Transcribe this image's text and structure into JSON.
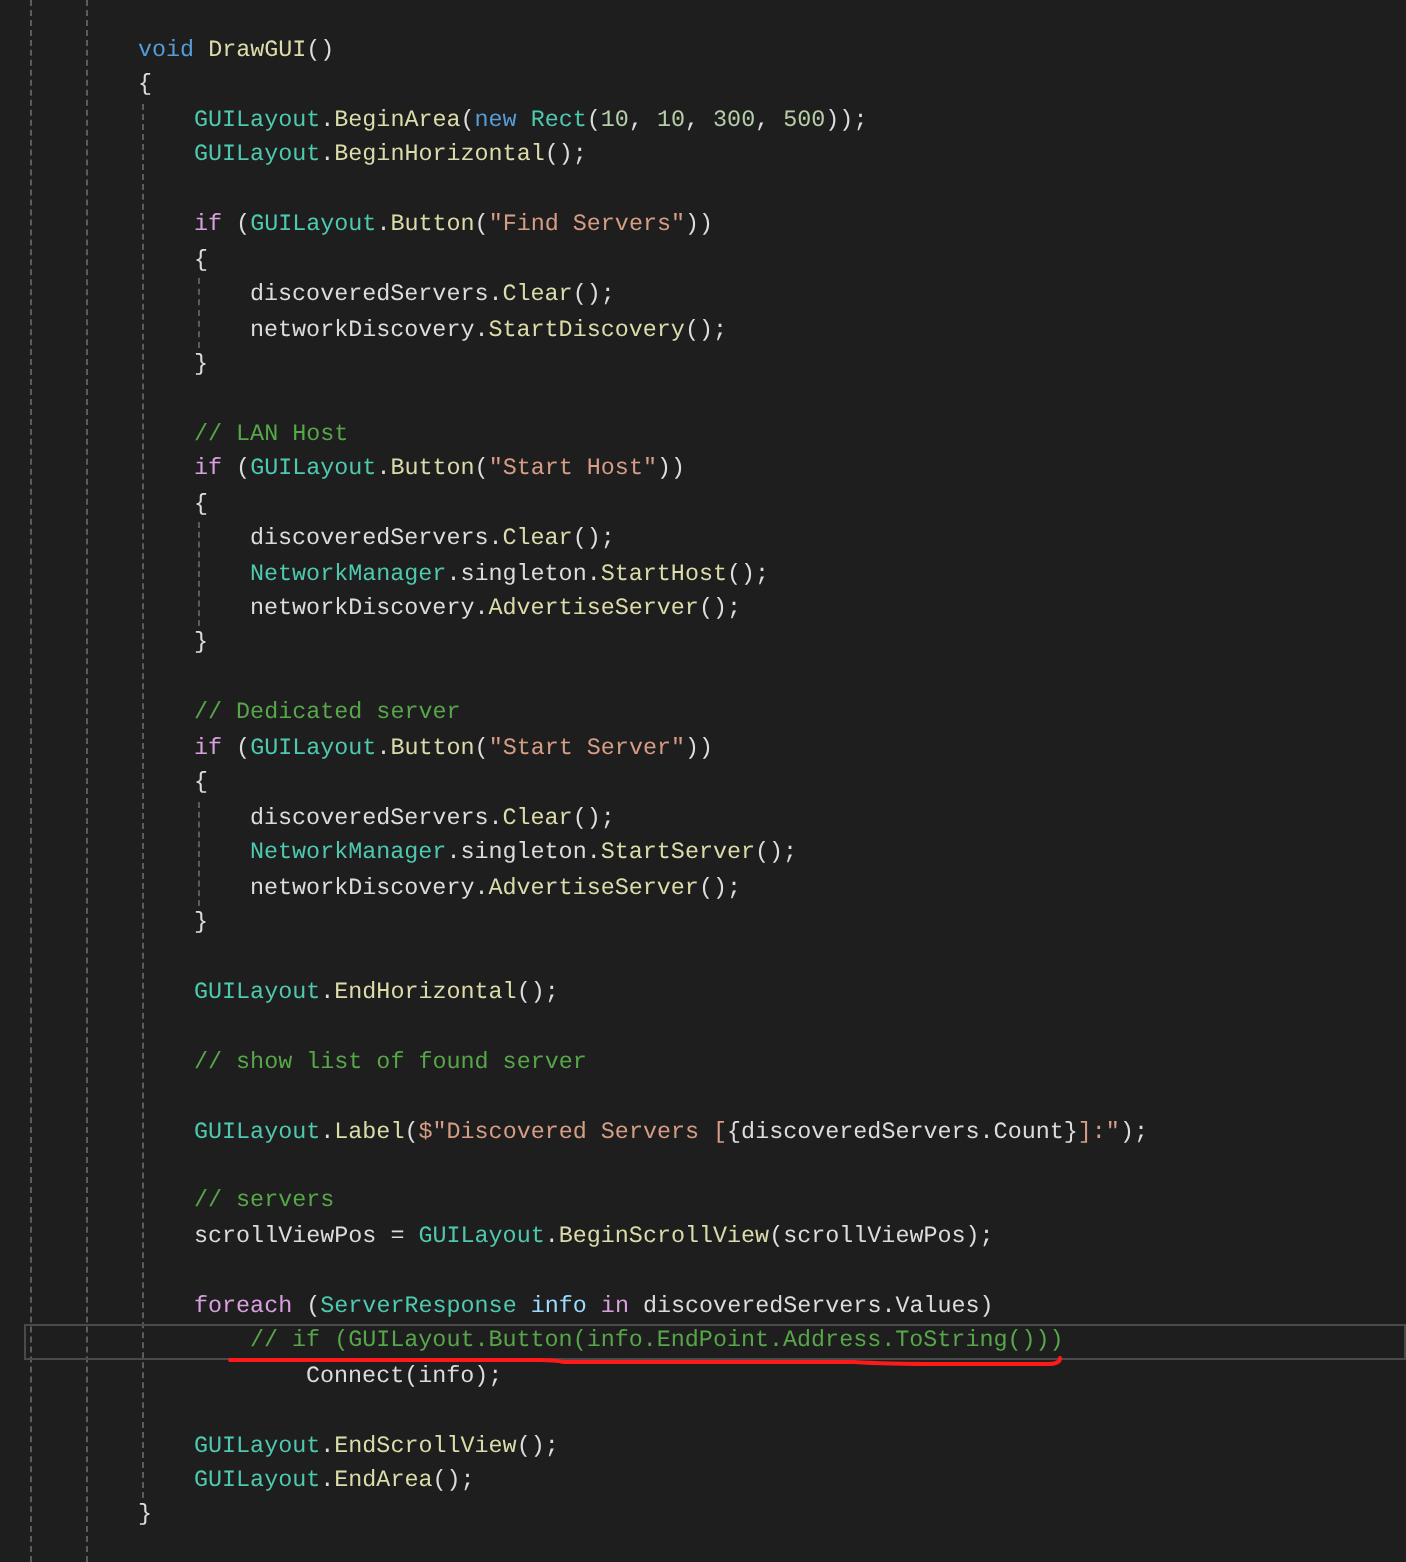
{
  "editor": {
    "code": [
      {
        "kind": "block",
        "children": [
          {
            "kind": "block",
            "children": [
              {
                "kind": "line",
                "current": false,
                "tokens": [
                  {
                    "kind": "keyword",
                    "text": "void"
                  },
                  {
                    "kind": "method",
                    "text": " DrawGUI"
                  },
                  {
                    "kind": "plain",
                    "text": "()"
                  }
                ]
              },
              {
                "kind": "line",
                "current": false,
                "tokens": [
                  {
                    "kind": "plain",
                    "text": "{"
                  }
                ]
              },
              {
                "kind": "block",
                "children": [
                  {
                    "kind": "line",
                    "current": false,
                    "tokens": [
                      {
                        "kind": "type",
                        "text": "GUILayout"
                      },
                      {
                        "kind": "plain",
                        "text": "."
                      },
                      {
                        "kind": "method",
                        "text": "BeginArea"
                      },
                      {
                        "kind": "plain",
                        "text": "("
                      },
                      {
                        "kind": "keyword",
                        "text": "new"
                      },
                      {
                        "kind": "type",
                        "text": " Rect"
                      },
                      {
                        "kind": "plain",
                        "text": "("
                      },
                      {
                        "kind": "number",
                        "text": "10"
                      },
                      {
                        "kind": "plain",
                        "text": ", "
                      },
                      {
                        "kind": "number",
                        "text": "10"
                      },
                      {
                        "kind": "plain",
                        "text": ", "
                      },
                      {
                        "kind": "number",
                        "text": "300"
                      },
                      {
                        "kind": "plain",
                        "text": ", "
                      },
                      {
                        "kind": "number",
                        "text": "500"
                      },
                      {
                        "kind": "plain",
                        "text": "));"
                      }
                    ]
                  },
                  {
                    "kind": "line",
                    "current": false,
                    "tokens": [
                      {
                        "kind": "type",
                        "text": "GUILayout"
                      },
                      {
                        "kind": "plain",
                        "text": "."
                      },
                      {
                        "kind": "method",
                        "text": "BeginHorizontal"
                      },
                      {
                        "kind": "plain",
                        "text": "();"
                      }
                    ]
                  },
                  {
                    "kind": "blank"
                  },
                  {
                    "kind": "line",
                    "current": false,
                    "tokens": [
                      {
                        "kind": "control",
                        "text": "if"
                      },
                      {
                        "kind": "plain",
                        "text": " ("
                      },
                      {
                        "kind": "type",
                        "text": "GUILayout"
                      },
                      {
                        "kind": "plain",
                        "text": "."
                      },
                      {
                        "kind": "method",
                        "text": "Button"
                      },
                      {
                        "kind": "plain",
                        "text": "("
                      },
                      {
                        "kind": "string",
                        "text": "\"Find Servers\""
                      },
                      {
                        "kind": "plain",
                        "text": "))"
                      }
                    ]
                  },
                  {
                    "kind": "line",
                    "current": false,
                    "tokens": [
                      {
                        "kind": "plain",
                        "text": "{"
                      }
                    ]
                  },
                  {
                    "kind": "block",
                    "children": [
                      {
                        "kind": "line",
                        "current": false,
                        "tokens": [
                          {
                            "kind": "plain",
                            "text": "discoveredServers."
                          },
                          {
                            "kind": "method",
                            "text": "Clear"
                          },
                          {
                            "kind": "plain",
                            "text": "();"
                          }
                        ]
                      },
                      {
                        "kind": "line",
                        "current": false,
                        "tokens": [
                          {
                            "kind": "plain",
                            "text": "networkDiscovery."
                          },
                          {
                            "kind": "method",
                            "text": "StartDiscovery"
                          },
                          {
                            "kind": "plain",
                            "text": "();"
                          }
                        ]
                      }
                    ]
                  },
                  {
                    "kind": "line",
                    "current": false,
                    "tokens": [
                      {
                        "kind": "plain",
                        "text": "}"
                      }
                    ]
                  },
                  {
                    "kind": "blank"
                  },
                  {
                    "kind": "line",
                    "current": false,
                    "tokens": [
                      {
                        "kind": "comment",
                        "text": "// LAN Host"
                      }
                    ]
                  },
                  {
                    "kind": "line",
                    "current": false,
                    "tokens": [
                      {
                        "kind": "control",
                        "text": "if"
                      },
                      {
                        "kind": "plain",
                        "text": " ("
                      },
                      {
                        "kind": "type",
                        "text": "GUILayout"
                      },
                      {
                        "kind": "plain",
                        "text": "."
                      },
                      {
                        "kind": "method",
                        "text": "Button"
                      },
                      {
                        "kind": "plain",
                        "text": "("
                      },
                      {
                        "kind": "string",
                        "text": "\"Start Host\""
                      },
                      {
                        "kind": "plain",
                        "text": "))"
                      }
                    ]
                  },
                  {
                    "kind": "line",
                    "current": false,
                    "tokens": [
                      {
                        "kind": "plain",
                        "text": "{"
                      }
                    ]
                  },
                  {
                    "kind": "block",
                    "children": [
                      {
                        "kind": "line",
                        "current": false,
                        "tokens": [
                          {
                            "kind": "plain",
                            "text": "discoveredServers."
                          },
                          {
                            "kind": "method",
                            "text": "Clear"
                          },
                          {
                            "kind": "plain",
                            "text": "();"
                          }
                        ]
                      },
                      {
                        "kind": "line",
                        "current": false,
                        "tokens": [
                          {
                            "kind": "type",
                            "text": "NetworkManager"
                          },
                          {
                            "kind": "plain",
                            "text": ".singleton."
                          },
                          {
                            "kind": "method",
                            "text": "StartHost"
                          },
                          {
                            "kind": "plain",
                            "text": "();"
                          }
                        ]
                      },
                      {
                        "kind": "line",
                        "current": false,
                        "tokens": [
                          {
                            "kind": "plain",
                            "text": "networkDiscovery."
                          },
                          {
                            "kind": "method",
                            "text": "AdvertiseServer"
                          },
                          {
                            "kind": "plain",
                            "text": "();"
                          }
                        ]
                      }
                    ]
                  },
                  {
                    "kind": "line",
                    "current": false,
                    "tokens": [
                      {
                        "kind": "plain",
                        "text": "}"
                      }
                    ]
                  },
                  {
                    "kind": "blank"
                  },
                  {
                    "kind": "line",
                    "current": false,
                    "tokens": [
                      {
                        "kind": "comment",
                        "text": "// Dedicated server"
                      }
                    ]
                  },
                  {
                    "kind": "line",
                    "current": false,
                    "tokens": [
                      {
                        "kind": "control",
                        "text": "if"
                      },
                      {
                        "kind": "plain",
                        "text": " ("
                      },
                      {
                        "kind": "type",
                        "text": "GUILayout"
                      },
                      {
                        "kind": "plain",
                        "text": "."
                      },
                      {
                        "kind": "method",
                        "text": "Button"
                      },
                      {
                        "kind": "plain",
                        "text": "("
                      },
                      {
                        "kind": "string",
                        "text": "\"Start Server\""
                      },
                      {
                        "kind": "plain",
                        "text": "))"
                      }
                    ]
                  },
                  {
                    "kind": "line",
                    "current": false,
                    "tokens": [
                      {
                        "kind": "plain",
                        "text": "{"
                      }
                    ]
                  },
                  {
                    "kind": "block",
                    "children": [
                      {
                        "kind": "line",
                        "current": false,
                        "tokens": [
                          {
                            "kind": "plain",
                            "text": "discoveredServers."
                          },
                          {
                            "kind": "method",
                            "text": "Clear"
                          },
                          {
                            "kind": "plain",
                            "text": "();"
                          }
                        ]
                      },
                      {
                        "kind": "line",
                        "current": false,
                        "tokens": [
                          {
                            "kind": "type",
                            "text": "NetworkManager"
                          },
                          {
                            "kind": "plain",
                            "text": ".singleton."
                          },
                          {
                            "kind": "method",
                            "text": "StartServer"
                          },
                          {
                            "kind": "plain",
                            "text": "();"
                          }
                        ]
                      },
                      {
                        "kind": "line",
                        "current": false,
                        "tokens": [
                          {
                            "kind": "plain",
                            "text": "networkDiscovery."
                          },
                          {
                            "kind": "method",
                            "text": "AdvertiseServer"
                          },
                          {
                            "kind": "plain",
                            "text": "();"
                          }
                        ]
                      }
                    ]
                  },
                  {
                    "kind": "line",
                    "current": false,
                    "tokens": [
                      {
                        "kind": "plain",
                        "text": "}"
                      }
                    ]
                  },
                  {
                    "kind": "blank"
                  },
                  {
                    "kind": "line",
                    "current": false,
                    "tokens": [
                      {
                        "kind": "type",
                        "text": "GUILayout"
                      },
                      {
                        "kind": "plain",
                        "text": "."
                      },
                      {
                        "kind": "method",
                        "text": "EndHorizontal"
                      },
                      {
                        "kind": "plain",
                        "text": "();"
                      }
                    ]
                  },
                  {
                    "kind": "blank"
                  },
                  {
                    "kind": "line",
                    "current": false,
                    "tokens": [
                      {
                        "kind": "comment",
                        "text": "// show list of found server"
                      }
                    ]
                  },
                  {
                    "kind": "blank"
                  },
                  {
                    "kind": "line",
                    "current": false,
                    "tokens": [
                      {
                        "kind": "type",
                        "text": "GUILayout"
                      },
                      {
                        "kind": "plain",
                        "text": "."
                      },
                      {
                        "kind": "method",
                        "text": "Label"
                      },
                      {
                        "kind": "plain",
                        "text": "("
                      },
                      {
                        "kind": "string",
                        "text": "$\"Discovered Servers ["
                      },
                      {
                        "kind": "plain",
                        "text": "{discoveredServers.Count}"
                      },
                      {
                        "kind": "string",
                        "text": "]:\""
                      },
                      {
                        "kind": "plain",
                        "text": ");"
                      }
                    ]
                  },
                  {
                    "kind": "blank"
                  },
                  {
                    "kind": "line",
                    "current": false,
                    "tokens": [
                      {
                        "kind": "comment",
                        "text": "// servers"
                      }
                    ]
                  },
                  {
                    "kind": "line",
                    "current": false,
                    "tokens": [
                      {
                        "kind": "plain",
                        "text": "scrollViewPos = "
                      },
                      {
                        "kind": "type",
                        "text": "GUILayout"
                      },
                      {
                        "kind": "plain",
                        "text": "."
                      },
                      {
                        "kind": "method",
                        "text": "BeginScrollView"
                      },
                      {
                        "kind": "plain",
                        "text": "(scrollViewPos);"
                      }
                    ]
                  },
                  {
                    "kind": "blank"
                  },
                  {
                    "kind": "line",
                    "current": false,
                    "tokens": [
                      {
                        "kind": "control",
                        "text": "foreach"
                      },
                      {
                        "kind": "plain",
                        "text": " ("
                      },
                      {
                        "kind": "type",
                        "text": "ServerResponse"
                      },
                      {
                        "kind": "local",
                        "text": " info"
                      },
                      {
                        "kind": "control",
                        "text": " in"
                      },
                      {
                        "kind": "plain",
                        "text": " discoveredServers.Values)"
                      }
                    ]
                  },
                  {
                    "kind": "indent",
                    "children": [
                      {
                        "kind": "line",
                        "current": true,
                        "tokens": [
                          {
                            "kind": "comment",
                            "text": "// if (GUILayout.Button(info.EndPoint.Address.ToString()))"
                          }
                        ]
                      },
                      {
                        "kind": "indent",
                        "children": [
                          {
                            "kind": "line",
                            "current": false,
                            "tokens": [
                              {
                                "kind": "plain",
                                "text": "Connect(info);"
                              }
                            ]
                          }
                        ]
                      }
                    ]
                  },
                  {
                    "kind": "blank"
                  },
                  {
                    "kind": "line",
                    "current": false,
                    "tokens": [
                      {
                        "kind": "type",
                        "text": "GUILayout"
                      },
                      {
                        "kind": "plain",
                        "text": "."
                      },
                      {
                        "kind": "method",
                        "text": "EndScrollView"
                      },
                      {
                        "kind": "plain",
                        "text": "();"
                      }
                    ]
                  },
                  {
                    "kind": "line",
                    "current": false,
                    "tokens": [
                      {
                        "kind": "type",
                        "text": "GUILayout"
                      },
                      {
                        "kind": "plain",
                        "text": "."
                      },
                      {
                        "kind": "method",
                        "text": "EndArea"
                      },
                      {
                        "kind": "plain",
                        "text": "();"
                      }
                    ]
                  }
                ]
              },
              {
                "kind": "line",
                "current": false,
                "tokens": [
                  {
                    "kind": "plain",
                    "text": "}"
                  }
                ]
              }
            ]
          }
        ]
      }
    ]
  }
}
